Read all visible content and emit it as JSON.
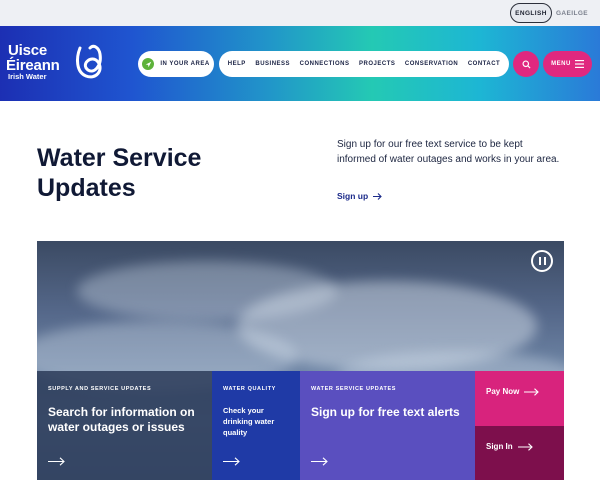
{
  "language": {
    "english": "ENGLISH",
    "irish": "GAEILGE"
  },
  "brand": {
    "line1": "Uisce",
    "line2": "Éireann",
    "line3": "Irish Water"
  },
  "header": {
    "in_your_area": "IN YOUR AREA",
    "nav": [
      "HELP",
      "BUSINESS",
      "CONNECTIONS",
      "PROJECTS",
      "CONSERVATION",
      "CONTACT"
    ],
    "menu": "MENU"
  },
  "intro": {
    "title_line1": "Water Service",
    "title_line2": "Updates",
    "text": "Sign up for our free text service to be kept informed of water outages and works in your area.",
    "link": "Sign up"
  },
  "tiles": [
    {
      "caption": "SUPPLY AND SERVICE UPDATES",
      "heading": "Search for information on water outages or issues"
    },
    {
      "caption": "WATER QUALITY",
      "heading": "Check your drinking water quality"
    },
    {
      "caption": "WATER SERVICE UPDATES",
      "heading": "Sign up for free text alerts"
    }
  ],
  "actions": {
    "pay": "Pay Now",
    "signin": "Sign In"
  },
  "colors": {
    "accent_pink": "#e0287f",
    "navy": "#1b2a8a",
    "tile_blue": "#1f3aa6",
    "tile_purple": "#5a4fbf",
    "tile_maroon": "#7d0f4c"
  },
  "icons": {
    "area": "location-arrow-icon",
    "search": "search-icon",
    "menu": "hamburger-icon",
    "pause": "pause-icon",
    "arrow": "arrow-right-icon"
  }
}
